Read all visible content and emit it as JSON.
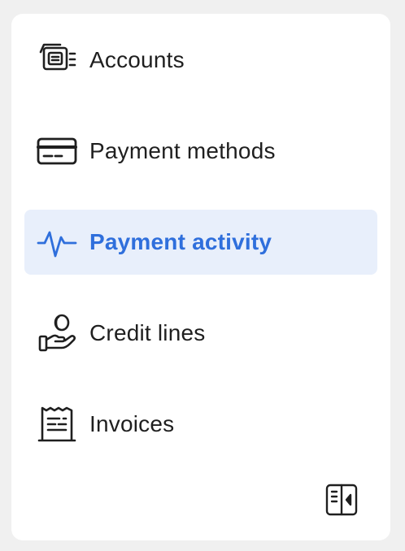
{
  "sidebar": {
    "items": [
      {
        "label": "Accounts",
        "icon": "accounts-icon",
        "active": false
      },
      {
        "label": "Payment methods",
        "icon": "credit-card-icon",
        "active": false
      },
      {
        "label": "Payment activity",
        "icon": "activity-pulse-icon",
        "active": true
      },
      {
        "label": "Credit lines",
        "icon": "hand-coin-icon",
        "active": false
      },
      {
        "label": "Invoices",
        "icon": "receipt-icon",
        "active": false
      }
    ],
    "collapse_icon": "collapse-sidebar-icon"
  },
  "colors": {
    "active_text": "#2f6fdc",
    "active_background": "#e8effb",
    "text": "#1f1f1f",
    "page_background": "#f0f0f0",
    "panel_background": "#ffffff"
  }
}
